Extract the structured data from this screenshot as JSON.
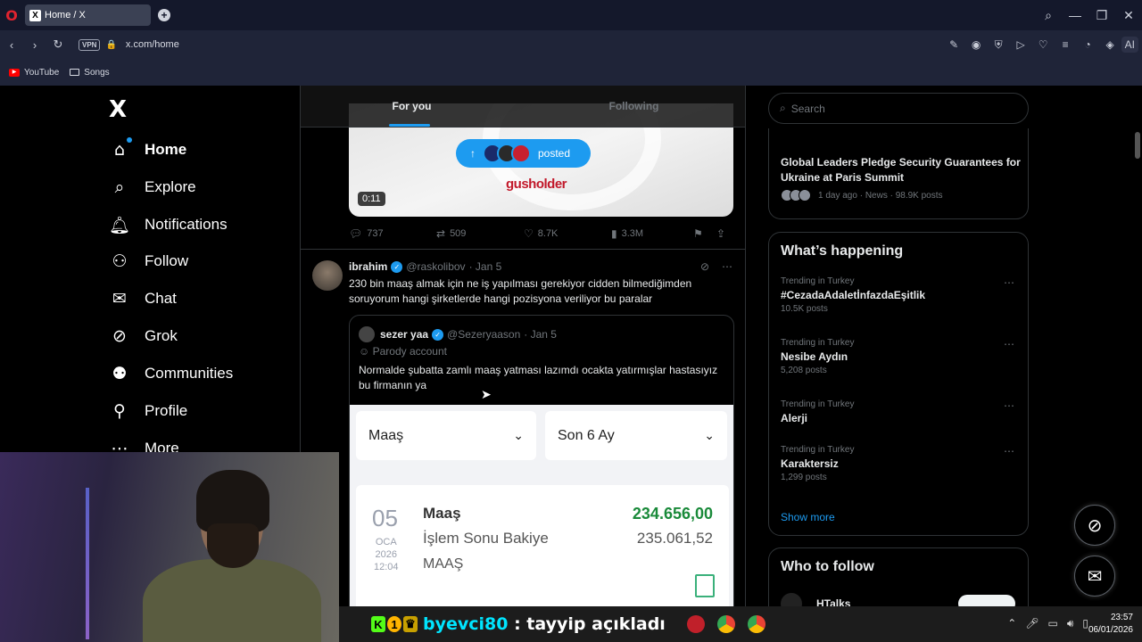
{
  "browser": {
    "logo": "O",
    "tab_title": "Home / X",
    "tab_favicon": "X",
    "new_tab": "+",
    "url": "x.com/home",
    "vpn": "VPN",
    "ai_label": "AI",
    "bookmarks": [
      {
        "label": "YouTube",
        "icon": "youtube-icon"
      },
      {
        "label": "Songs",
        "icon": "folder-icon"
      }
    ]
  },
  "nav": {
    "logo": "X",
    "items": [
      {
        "label": "Home",
        "icon": "home-icon"
      },
      {
        "label": "Explore",
        "icon": "search-icon"
      },
      {
        "label": "Notifications",
        "icon": "bell-icon"
      },
      {
        "label": "Follow",
        "icon": "follow-icon"
      },
      {
        "label": "Chat",
        "icon": "mail-icon"
      },
      {
        "label": "Grok",
        "icon": "grok-icon"
      },
      {
        "label": "Communities",
        "icon": "communities-icon"
      },
      {
        "label": "Profile",
        "icon": "profile-icon"
      },
      {
        "label": "More",
        "icon": "more-icon"
      }
    ]
  },
  "feed": {
    "tabs": [
      "For you",
      "Following"
    ],
    "post1": {
      "posted_label": "posted",
      "brand": "gusholder",
      "duration": "0:11",
      "replies": "737",
      "reposts": "509",
      "likes": "8.7K",
      "views": "3.3M"
    },
    "post2": {
      "name": "ibrahim",
      "handle": "@raskolibov",
      "date": "· Jan 5",
      "text": "230 bin maaş almak için ne iş yapılması gerekiyor cidden bilmediğimden soruyorum hangi şirketlerde hangi pozisyona veriliyor bu paralar",
      "quote": {
        "name": "sezer yaa",
        "handle": "@Sezeryaason",
        "date": "· Jan 5",
        "parody": "Parody account",
        "text": "Normalde şubatta zamlı maaş yatması lazımdı ocakta yatırmışlar hastasıyız bu firmanın ya",
        "image": {
          "select1": "Maaş",
          "select2": "Son 6 Ay",
          "day": "05",
          "month": "OCA",
          "year": "2026",
          "time": "12:04",
          "title": "Maaş",
          "amount": "234.656,00",
          "subtitle": "İşlem Sonu Bakiye",
          "balance": "235.061,52",
          "desc": "MAAŞ"
        }
      }
    }
  },
  "sidebar": {
    "search_placeholder": "Search",
    "news": {
      "title": "Global Leaders Pledge Security Guarantees for Ukraine at Paris Summit",
      "meta": "1 day ago · News · 98.9K posts"
    },
    "whats_happening": "What’s happening",
    "trends": [
      {
        "context": "Trending in Turkey",
        "name": "#CezadaAdaletİnfazdaEşitlik",
        "count": "10.5K posts"
      },
      {
        "context": "Trending in Turkey",
        "name": "Nesibe Aydın",
        "count": "5,208 posts"
      },
      {
        "context": "Trending in Turkey",
        "name": "Alerji",
        "count": ""
      },
      {
        "context": "Trending in Turkey",
        "name": "Karaktersiz",
        "count": "1,299 posts"
      }
    ],
    "show_more": "Show more",
    "who_to_follow": "Who to follow",
    "suggestion": "HTalks"
  },
  "taskbar": {
    "ticker_user": "byevci80",
    "ticker_msg": " : tayyip açıkladı",
    "time": "23:57",
    "date": "06/01/2026"
  },
  "colors": {
    "accent": "#1d9bf0",
    "background": "#000000",
    "border": "#2f3336"
  }
}
